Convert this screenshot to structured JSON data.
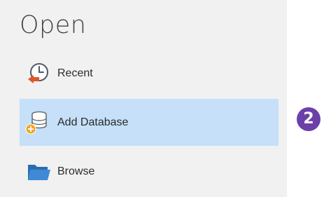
{
  "header": {
    "title": "Open"
  },
  "menu": {
    "items": [
      {
        "label": "Recent",
        "icon": "clock-arrow-icon"
      },
      {
        "label": "Add Database",
        "icon": "database-add-icon",
        "selected": true
      },
      {
        "label": "Browse",
        "icon": "folder-icon"
      }
    ]
  },
  "step_badge": {
    "number": "2"
  },
  "colors": {
    "panel_bg": "#f1f1f1",
    "selected_bg": "#c5e0f8",
    "badge_bg": "#6b40a8"
  }
}
